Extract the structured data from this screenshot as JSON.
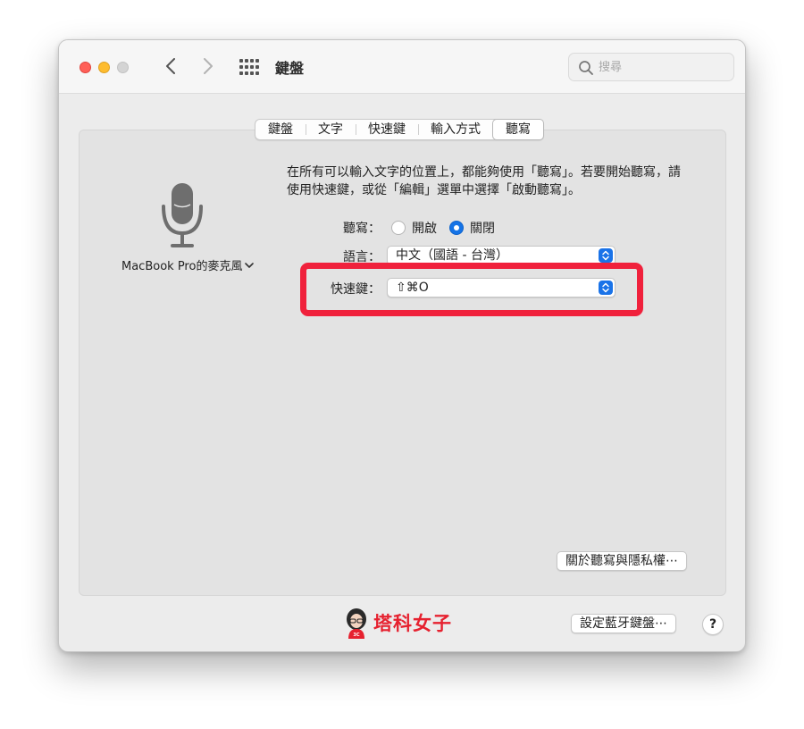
{
  "window": {
    "title": "鍵盤"
  },
  "search": {
    "placeholder": "搜尋"
  },
  "tabs": [
    {
      "label": "鍵盤"
    },
    {
      "label": "文字"
    },
    {
      "label": "快速鍵"
    },
    {
      "label": "輸入方式"
    },
    {
      "label": "聽寫",
      "active": true
    }
  ],
  "microphone": {
    "label": "MacBook Pro的麥克風",
    "icon": "microphone-icon"
  },
  "description": "在所有可以輸入文字的位置上，都能夠使用「聽寫」。若要開始聽寫，請使用快速鍵，或從「編輯」選單中選擇「啟動聽寫」。",
  "dictation": {
    "label": "聽寫：",
    "options": [
      {
        "label": "開啟",
        "selected": false
      },
      {
        "label": "關閉",
        "selected": true
      }
    ]
  },
  "language": {
    "label": "語言：",
    "value": "中文（國語 - 台灣）"
  },
  "shortcut": {
    "label": "快速鍵：",
    "value": "⇧⌘O"
  },
  "buttons": {
    "privacy": "關於聽寫與隱私權⋯",
    "bluetooth_keyboard": "設定藍牙鍵盤⋯",
    "help": "?"
  },
  "watermark": {
    "text": "塔科女子"
  },
  "colors": {
    "accent": "#1473e6",
    "highlight": "#f0213c",
    "brand": "#e6212f"
  }
}
